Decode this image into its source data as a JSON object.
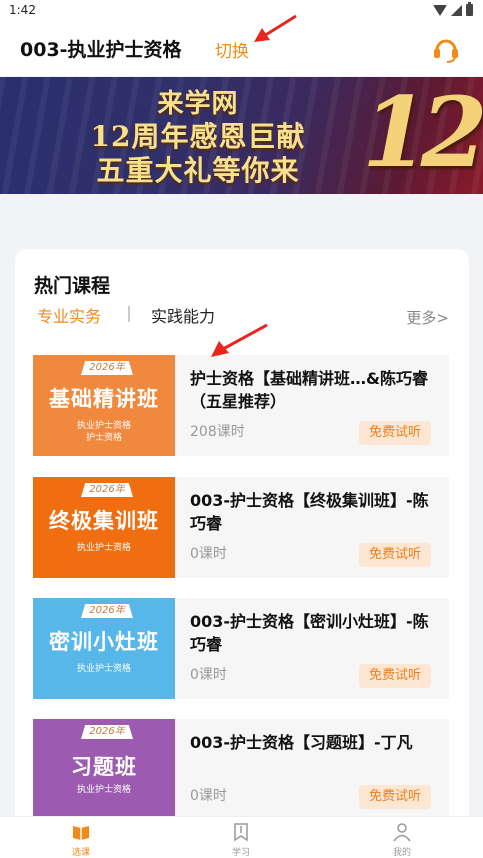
{
  "status_bar": {
    "time": "1:42"
  },
  "header": {
    "title": "003-执业护士资格",
    "switch_label": "切换"
  },
  "banner": {
    "line1": "来学网",
    "line2": "12周年感恩巨献",
    "line3": "五重大礼等你来",
    "big_number": "12"
  },
  "section": {
    "title": "热门课程",
    "tabs": [
      {
        "label": "专业实务",
        "active": true
      },
      {
        "label": "实践能力",
        "active": false
      }
    ],
    "more_label": "更多>"
  },
  "courses": [
    {
      "thumb_year": "2026年",
      "thumb_name": "基础精讲班",
      "thumb_sub1": "执业护士资格",
      "thumb_sub2": "护士资格",
      "thumb_color": "#f0883e",
      "name": "护士资格【基础精讲班…&陈巧睿（五星推荐）",
      "hours": "208课时",
      "trial_label": "免费试听"
    },
    {
      "thumb_year": "2026年",
      "thumb_name": "终极集训班",
      "thumb_sub1": "执业护士资格",
      "thumb_color": "#f06d10",
      "name": "003-护士资格【终极集训班】-陈巧睿",
      "hours": "0课时",
      "trial_label": "免费试听"
    },
    {
      "thumb_year": "2026年",
      "thumb_name": "密训小灶班",
      "thumb_sub1": "执业护士资格",
      "thumb_color": "#56b7e8",
      "name": "003-护士资格【密训小灶班】-陈巧睿",
      "hours": "0课时",
      "trial_label": "免费试听"
    },
    {
      "thumb_year": "2026年",
      "thumb_name": "习题班",
      "thumb_sub1": "执业护士资格",
      "thumb_color": "#9c5ab0",
      "name": "003-护士资格【习题班】-丁凡",
      "hours": "0课时",
      "trial_label": "免费试听"
    }
  ],
  "tabbar": [
    {
      "label": "选课",
      "icon": "book-icon",
      "active": true
    },
    {
      "label": "学习",
      "icon": "bookmark-icon",
      "active": false
    },
    {
      "label": "我的",
      "icon": "user-icon",
      "active": false
    }
  ],
  "colors": {
    "accent": "#f08a18"
  }
}
